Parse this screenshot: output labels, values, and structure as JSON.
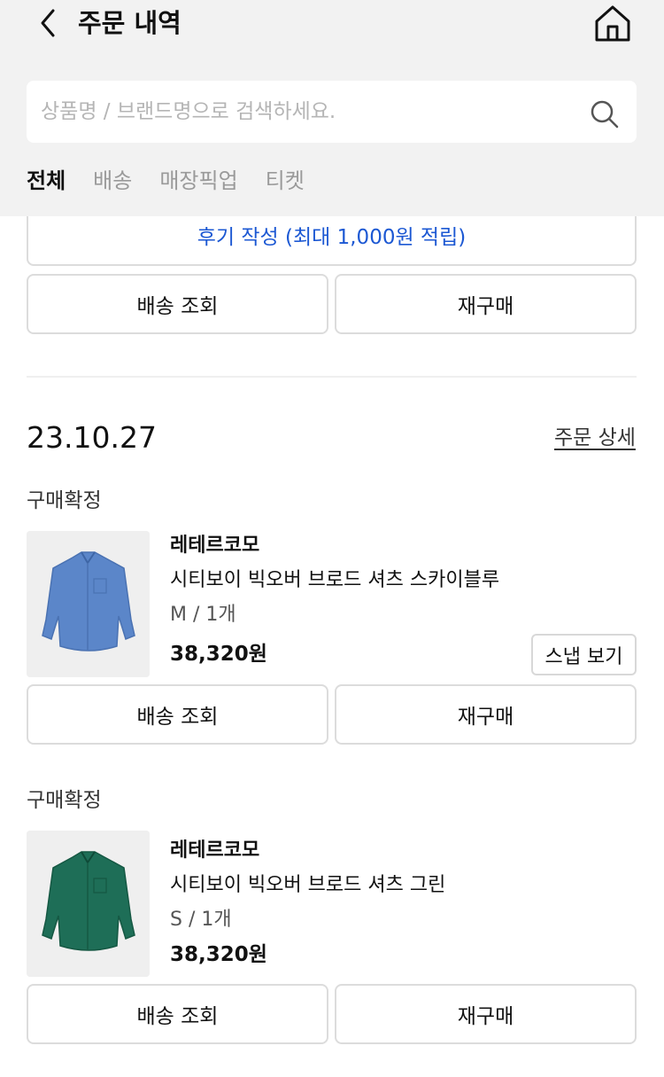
{
  "header": {
    "title": "주문 내역",
    "back_icon": "chevron-left-icon",
    "home_icon": "home-icon"
  },
  "search": {
    "placeholder": "상품명 / 브랜드명으로 검색하세요.",
    "value": "",
    "icon": "search-icon"
  },
  "tabs": [
    {
      "label": "전체",
      "active": true
    },
    {
      "label": "배송",
      "active": false
    },
    {
      "label": "매장픽업",
      "active": false
    },
    {
      "label": "티켓",
      "active": false
    }
  ],
  "previous_order": {
    "review_button": "후기 작성 (최대 1,000원 적립)",
    "track_button": "배송 조회",
    "rebuy_button": "재구매"
  },
  "order": {
    "date": "23.10.27",
    "detail_link": "주문 상세",
    "items": [
      {
        "status": "구매확정",
        "brand": "레테르코모",
        "name": "시티보이 빅오버 브로드 셔츠 스카이블루",
        "option": "M / 1개",
        "price": "38,320원",
        "snap_button": "스냅 보기",
        "track_button": "배송 조회",
        "rebuy_button": "재구매",
        "image_color": "#5b86c9"
      },
      {
        "status": "구매확정",
        "brand": "레테르코모",
        "name": "시티보이 빅오버 브로드 셔츠 그린",
        "option": "S / 1개",
        "price": "38,320원",
        "track_button": "배송 조회",
        "rebuy_button": "재구매",
        "image_color": "#1e6e57"
      }
    ]
  },
  "colors": {
    "header_bg": "#f2f2f2",
    "review_link": "#1c58d3",
    "border": "#dcdcdc"
  }
}
